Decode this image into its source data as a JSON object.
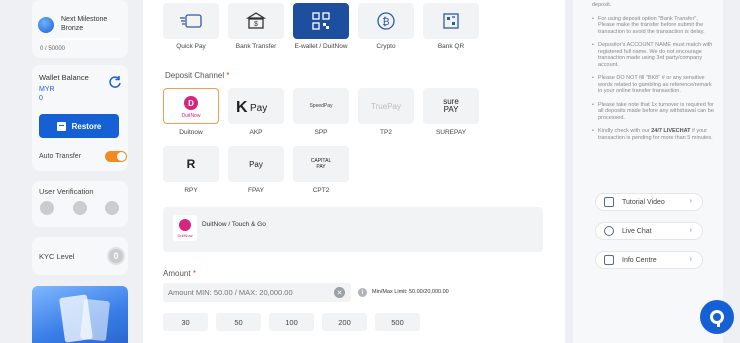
{
  "milestone": {
    "title": "Next Milestone Bronze",
    "progress": "0 / 50000"
  },
  "wallet": {
    "label": "Wallet Balance",
    "currency": "MYR",
    "amount": "0",
    "restore_label": "Restore",
    "auto_transfer_label": "Auto Transfer",
    "auto_transfer_on": true
  },
  "verification": {
    "label": "User Verification"
  },
  "kyc": {
    "label": "KYC Level",
    "value": "0"
  },
  "methods": [
    {
      "label": "Quick Pay",
      "icon": "quick-pay-icon"
    },
    {
      "label": "Bank Transfer",
      "icon": "bank-icon"
    },
    {
      "label": "E-wallet / DuitNow",
      "icon": "qr-code-icon",
      "selected": true
    },
    {
      "label": "Crypto",
      "icon": "bitcoin-icon"
    },
    {
      "label": "Bank QR",
      "icon": "qr-icon"
    }
  ],
  "deposit_channel": {
    "label": "Deposit Channel",
    "required": "*",
    "channels": [
      {
        "label": "Duitnow",
        "logo": "DuitNow",
        "selected": true
      },
      {
        "label": "AKP",
        "logo": "Pay"
      },
      {
        "label": "SPP",
        "logo": "SpeedPay"
      },
      {
        "label": "TP2",
        "logo": "TruePay"
      },
      {
        "label": "SUREPAY",
        "logo": "sure PAY"
      },
      {
        "label": "RPY",
        "logo": "R"
      },
      {
        "label": "FPAY",
        "logo": "Pay"
      },
      {
        "label": "CPT2",
        "logo": "CAPITAL PAY"
      }
    ],
    "selected_text": "DuitNow / Touch & Go",
    "selected_logo": "DuitNow"
  },
  "amount": {
    "label": "Amount",
    "required": "*",
    "placeholder": "Amount MIN: 50.00 / MAX: 20,000.00",
    "limit_text": "Min/Max Limit: 50.00/20,000.00",
    "quick_values": [
      "30",
      "50",
      "100",
      "200",
      "500"
    ]
  },
  "notes": [
    "For using deposit option \"Bank Transfer\", Please make the transfer before submit the transaction to avoid the transaction is delay.",
    "Depositor's ACCOUNT NAME must match with registered full name. We do not encourage transaction made using 3rd party/company account.",
    "Please DO NOT fill \"BK8\" # or any sensitive words related to gambling as reference/remark in your online transfer transaction.",
    "Please take note that 1x turnover is required for all deposits made before any withdrawal can be processed."
  ],
  "note_partial_top": "deposit.",
  "livechat_note": {
    "pre": "Kindly check with our ",
    "bold": "24/7 LIVECHAT",
    "post": " if your transaction is pending for more than 5 minutes."
  },
  "help_buttons": [
    {
      "label": "Tutorial Video",
      "icon": "video-icon"
    },
    {
      "label": "Live Chat",
      "icon": "chat-icon"
    },
    {
      "label": "Info Centre",
      "icon": "info-centre-icon"
    }
  ],
  "colors": {
    "primary": "#1660d6",
    "accent": "#f08a24",
    "selected_border": "#f29b51",
    "required": "#e53935"
  }
}
